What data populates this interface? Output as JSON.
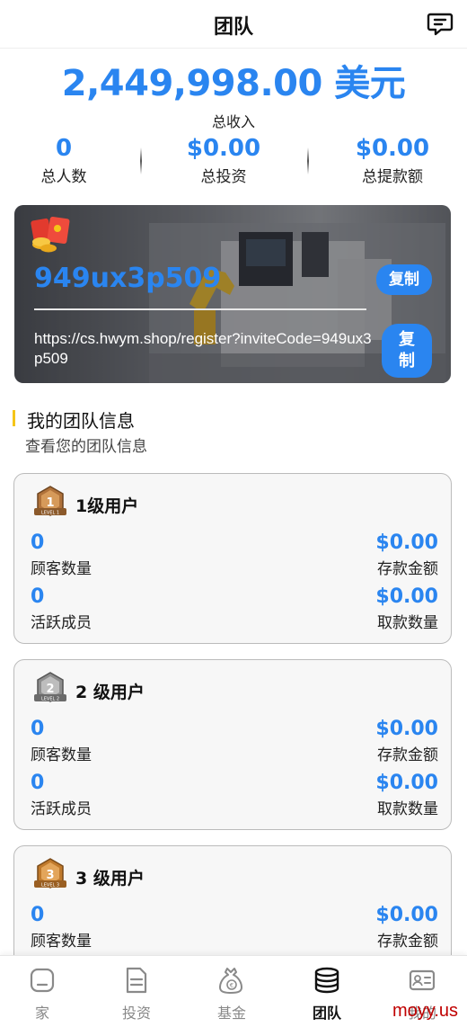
{
  "header": {
    "title": "团队",
    "menu_icon": "message-list-icon"
  },
  "summary": {
    "total_income": "2,449,998.00 美元",
    "total_income_label": "总收入"
  },
  "stats": [
    {
      "value": "0",
      "label": "总人数"
    },
    {
      "value": "$0.00",
      "label": "总投资"
    },
    {
      "value": "$0.00",
      "label": "总提款额"
    }
  ],
  "invite": {
    "icon": "red-envelope-icon",
    "code": "949ux3p509",
    "copy_code_label": "复制",
    "url": "https://cs.hwym.shop/register?inviteCode=949ux3p509",
    "copy_url_label": "复\n制"
  },
  "team_section": {
    "title": "我的团队信息",
    "subtitle": "查看您的团队信息"
  },
  "levels": [
    {
      "title": "1级用户",
      "badge_icon": "level-1-badge-icon",
      "customers": {
        "value": "0",
        "label": "顾客数量"
      },
      "deposits": {
        "value": "$0.00",
        "label": "存款金额"
      },
      "active": {
        "value": "0",
        "label": "活跃成员"
      },
      "withdrawals": {
        "value": "$0.00",
        "label": "取款数量"
      }
    },
    {
      "title": "2 级用户",
      "badge_icon": "level-2-badge-icon",
      "customers": {
        "value": "0",
        "label": "顾客数量"
      },
      "deposits": {
        "value": "$0.00",
        "label": "存款金额"
      },
      "active": {
        "value": "0",
        "label": "活跃成员"
      },
      "withdrawals": {
        "value": "$0.00",
        "label": "取款数量"
      }
    },
    {
      "title": "3 级用户",
      "badge_icon": "level-3-badge-icon",
      "customers": {
        "value": "0",
        "label": "顾客数量"
      },
      "deposits": {
        "value": "$0.00",
        "label": "存款金额"
      }
    }
  ],
  "tabbar": [
    {
      "label": "家",
      "icon": "home-icon",
      "active": false
    },
    {
      "label": "投资",
      "icon": "document-icon",
      "active": false
    },
    {
      "label": "基金",
      "icon": "money-bag-icon",
      "active": false
    },
    {
      "label": "团队",
      "icon": "coin-stack-icon",
      "active": true
    },
    {
      "label": "我的",
      "icon": "id-card-icon",
      "active": false
    }
  ],
  "watermark": "moyy.us",
  "colors": {
    "accent": "#2a85f0",
    "section_bar": "#f5c518",
    "active_tab": "#111111",
    "inactive_tab": "#888888"
  }
}
